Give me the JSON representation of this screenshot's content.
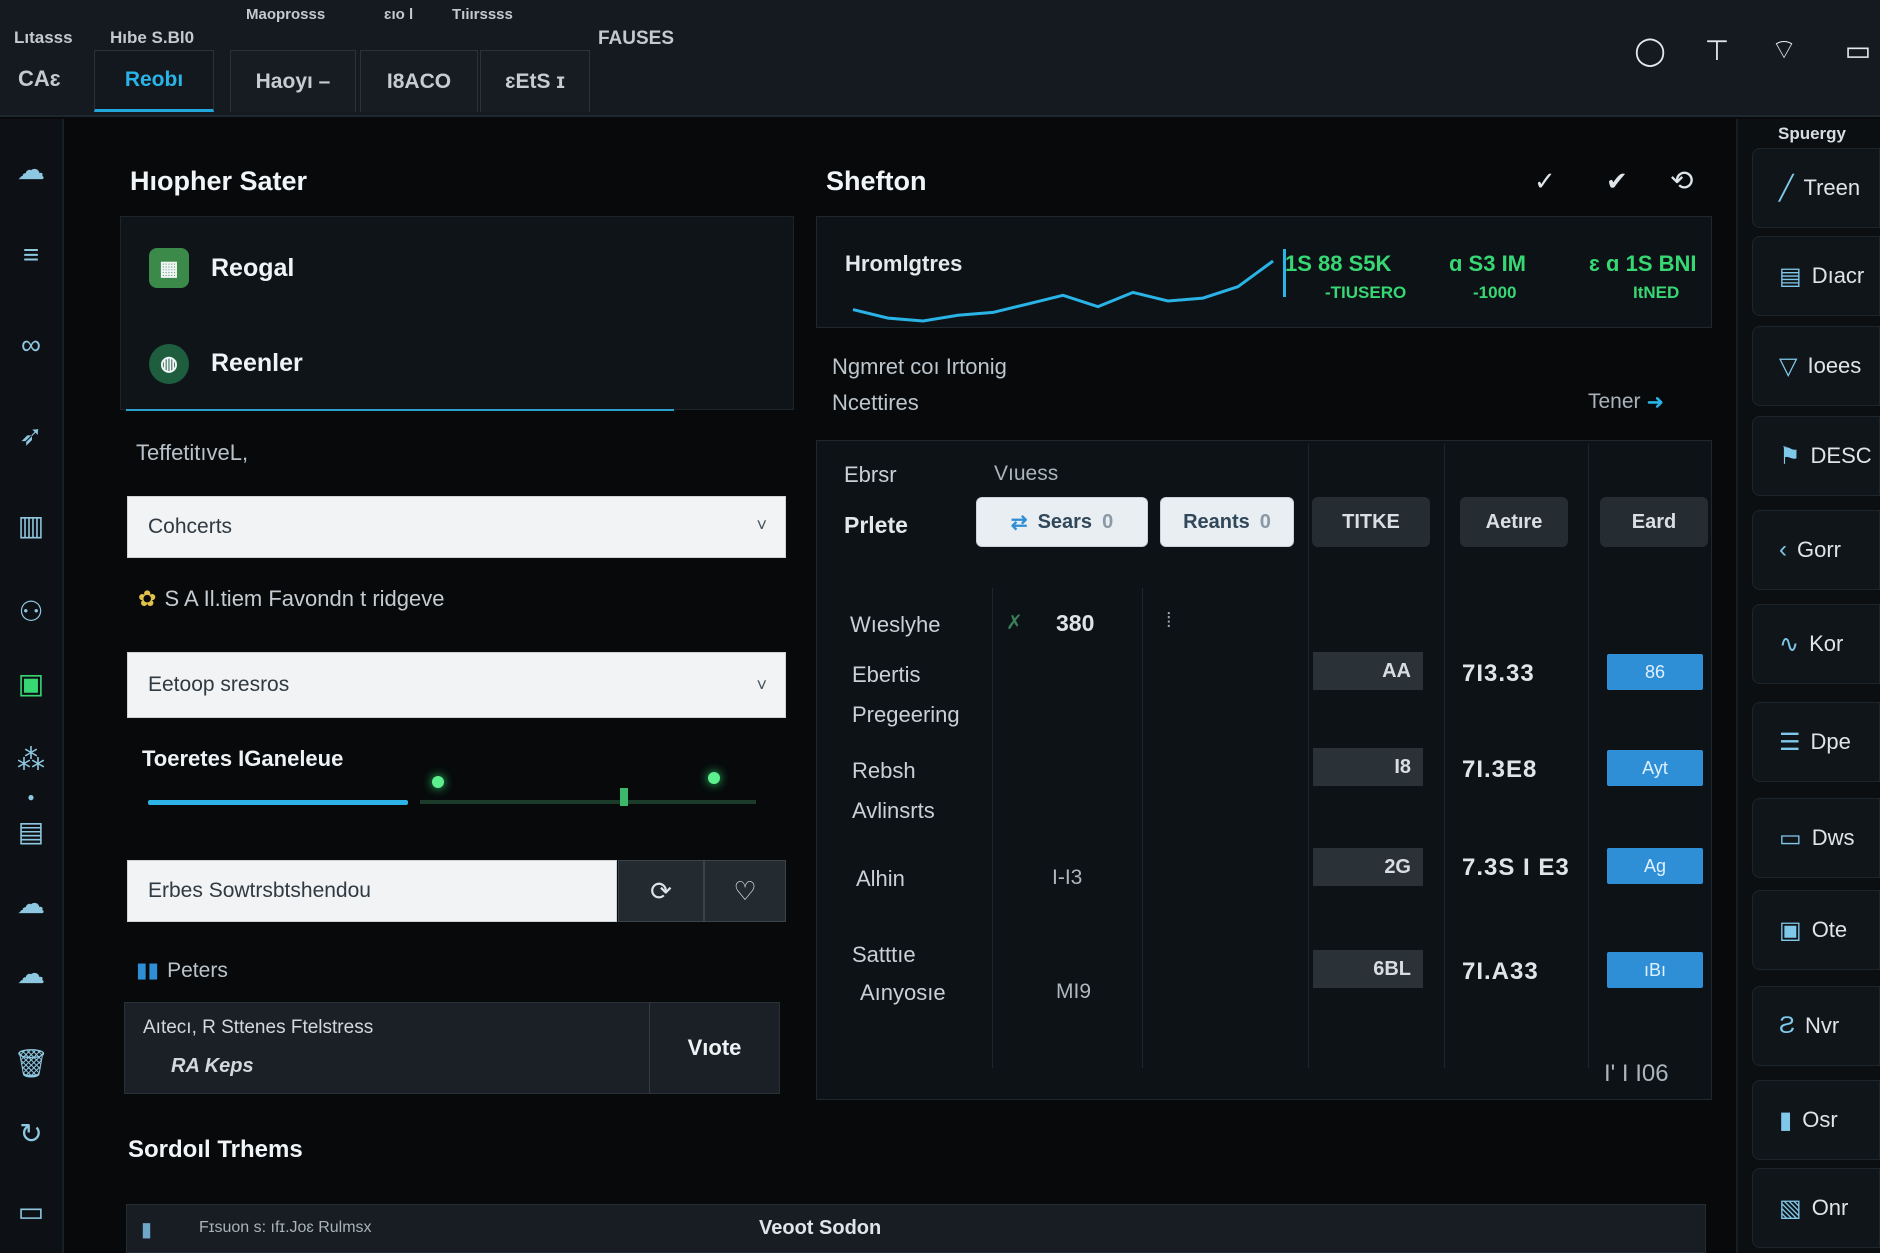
{
  "topbar": {
    "small_labels": [
      "Lıtasss",
      "Hıbe S.Bl0",
      "Maoprosss",
      "ɛıo l",
      "Tıiırssss"
    ],
    "center_label": "FAUSES",
    "left_code": "CAɛ",
    "tabs": [
      {
        "label": "Reobı",
        "active": true
      },
      {
        "label": "Haoyı –",
        "active": false
      },
      {
        "label": "I8ACO",
        "active": false
      },
      {
        "label": "ɛEtS ɪ",
        "active": false
      }
    ],
    "icons": [
      "circle-icon",
      "pin-icon",
      "chat-icon",
      "window-icon"
    ]
  },
  "left_rail": {
    "icons": [
      "cloud-icon",
      "layers-icon",
      "link-icon",
      "bird-icon",
      "chart-icon",
      "users-icon",
      "monitor-icon",
      "network-icon",
      "dot-icon",
      "database-icon",
      "cloud-small-icon",
      "cloud-alt-icon",
      "trash-icon",
      "refresh-icon",
      "screen-icon"
    ]
  },
  "left_panel": {
    "title": "Hıopher Sater",
    "cards": [
      {
        "label": "Reogal",
        "icon": "grid-icon"
      },
      {
        "label": "Reenler",
        "icon": "globe-icon"
      }
    ],
    "section_label": "TeffetitıveL,",
    "select_1": {
      "value": "Cohcerts"
    },
    "info_line": "S A Il.tiem Favondn t ridgeve",
    "select_2": {
      "value": "Eetoop sresros"
    },
    "slider": {
      "label": "Toeretes IGaneleue",
      "value": 0.4
    },
    "search_input": {
      "value": "Erbes Sowtrsbtshendou"
    },
    "action_icons": [
      "refresh-circle-icon",
      "heart-icon"
    ],
    "status_label": "Peters",
    "notice": {
      "line1": "Aıtecı, R Sttenes Ftelstress",
      "line2": "RA Keps",
      "button": "Vıote"
    },
    "section_bottom": "Sordoıl Trhems"
  },
  "center_panel": {
    "title": "Shefton",
    "header_icons": [
      "chevron-icon",
      "check-icon",
      "refresh-icon"
    ],
    "trend": {
      "label": "Hromlgtres",
      "values": [
        18,
        12,
        10,
        14,
        16,
        22,
        28,
        20,
        30,
        24,
        26,
        34,
        52
      ],
      "stats": [
        {
          "value": "1S 88  S5K",
          "sub": "‑TIUSERO"
        },
        {
          "value": "ɑ  S3  IM",
          "sub": "‑1000"
        },
        {
          "value": "ɛ  ɑ 1S BNI",
          "sub": "ItNED"
        }
      ],
      "accent": "#37d774"
    },
    "subhead": {
      "line1": "Ngmret coı Irtonig",
      "line2": "Ncettires",
      "link": "Tener"
    },
    "filters": {
      "label_a": "Ebrsr",
      "label_b": "Vıuess",
      "row_label": "Prlete",
      "pills": [
        {
          "label": "Sears",
          "count": "0"
        },
        {
          "label": "Reants",
          "count": "0"
        }
      ],
      "columns": [
        "TITKE",
        "Aetıre",
        "Eard"
      ]
    },
    "rows": [
      {
        "label1": "Wıeslyhe",
        "label2": "",
        "c1": "380",
        "c2": "",
        "bar": "",
        "value": "",
        "button": ""
      },
      {
        "label1": "Ebertis",
        "label2": "Pregeering",
        "c1": "",
        "c2": "",
        "bar": "AA",
        "value": "7I3.33",
        "button": "86"
      },
      {
        "label1": "Rebsh",
        "label2": "Avlinsrts",
        "c1": "",
        "c2": "",
        "bar": "I8",
        "value": "7I.3E8",
        "button": "Ayt"
      },
      {
        "label1": "Alhin",
        "label2": "",
        "c1": "I‑I3",
        "c2": "",
        "bar": "2G",
        "value": "7.3S I E3",
        "button": "Ag"
      },
      {
        "label1": "Satttıe",
        "label2": "Aınyosıe",
        "c1": "MI9",
        "c2": "",
        "bar": "6BL",
        "value": "7I.A33",
        "button": "ıBı"
      }
    ],
    "footer_value": "I' I  I06",
    "colors": {
      "primary": "#2f8fd6",
      "accent": "#2ab3e6"
    }
  },
  "right_rail": {
    "title": "Spuergy",
    "items": [
      {
        "label": "Treen",
        "icon": "trend-icon"
      },
      {
        "label": "Dıacr",
        "icon": "doc-icon"
      },
      {
        "label": "Ioees",
        "icon": "filter-icon"
      },
      {
        "label": "DESC",
        "icon": "flag-icon"
      },
      {
        "label": "Gorr",
        "icon": "arrow-icon"
      },
      {
        "label": "Kor",
        "icon": "wave-icon"
      },
      {
        "label": "Dpe",
        "icon": "list-icon"
      },
      {
        "label": "Dws",
        "icon": "folder-icon"
      },
      {
        "label": "Ote",
        "icon": "note-icon"
      },
      {
        "label": "Nvr",
        "icon": "s-icon"
      },
      {
        "label": "Osr",
        "icon": "box-icon"
      },
      {
        "label": "Onr",
        "icon": "bb-icon"
      }
    ]
  },
  "bottom": {
    "left": "Fɪsuon s: ıfɪ.Joɛ Rulmsx",
    "center": "Veoot Sodon"
  }
}
